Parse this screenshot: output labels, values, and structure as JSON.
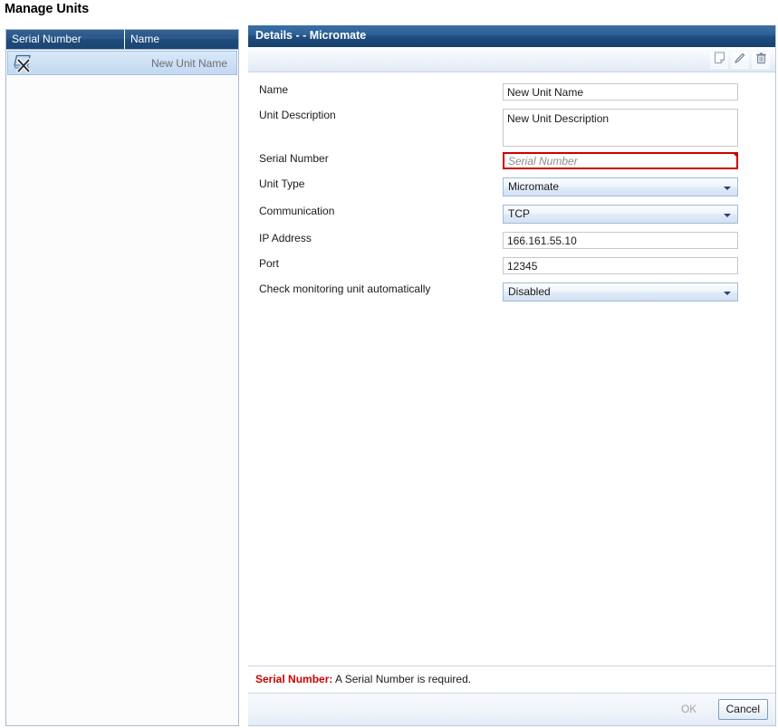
{
  "page": {
    "title": "Manage Units"
  },
  "unit_list": {
    "columns": [
      "Serial Number",
      "Name"
    ],
    "rows": [
      {
        "serial": "",
        "name": "New Unit Name",
        "icon": "disconnected-unit-icon",
        "selected": true
      }
    ]
  },
  "details": {
    "title": "Details -  - Micromate",
    "title_ghost": "",
    "toolbar": {
      "buttons": [
        {
          "name": "note-icon",
          "label": "Note"
        },
        {
          "name": "pencil-icon",
          "label": "Edit"
        },
        {
          "name": "trash-icon",
          "label": "Delete"
        }
      ]
    },
    "fields": [
      {
        "label": "Name",
        "type": "text",
        "value": "New Unit Name",
        "placeholder": ""
      },
      {
        "label": "Unit Description",
        "type": "textarea",
        "value": "New Unit Description",
        "placeholder": ""
      },
      {
        "label": "Serial Number",
        "type": "text",
        "value": "",
        "placeholder": "Serial Number",
        "error": true
      },
      {
        "label": "Unit Type",
        "type": "select",
        "value": "Micromate"
      },
      {
        "label": "Communication",
        "type": "select",
        "value": "TCP"
      },
      {
        "label": "IP Address",
        "type": "text",
        "value": "166.161.55.10",
        "placeholder": ""
      },
      {
        "label": "Port",
        "type": "text",
        "value": "12345",
        "placeholder": ""
      },
      {
        "label": "Check monitoring unit automatically",
        "type": "select",
        "value": "Disabled"
      }
    ],
    "validation": {
      "field": "Serial Number:",
      "message": "A Serial Number is required."
    },
    "footer": {
      "ok_label": "OK",
      "cancel_label": "Cancel",
      "ok_disabled": true
    }
  },
  "colors": {
    "title_bar": "#1f4e80",
    "list_header": "#24588c",
    "error_red": "#cc0000",
    "row_selected": "#cde0f4"
  }
}
